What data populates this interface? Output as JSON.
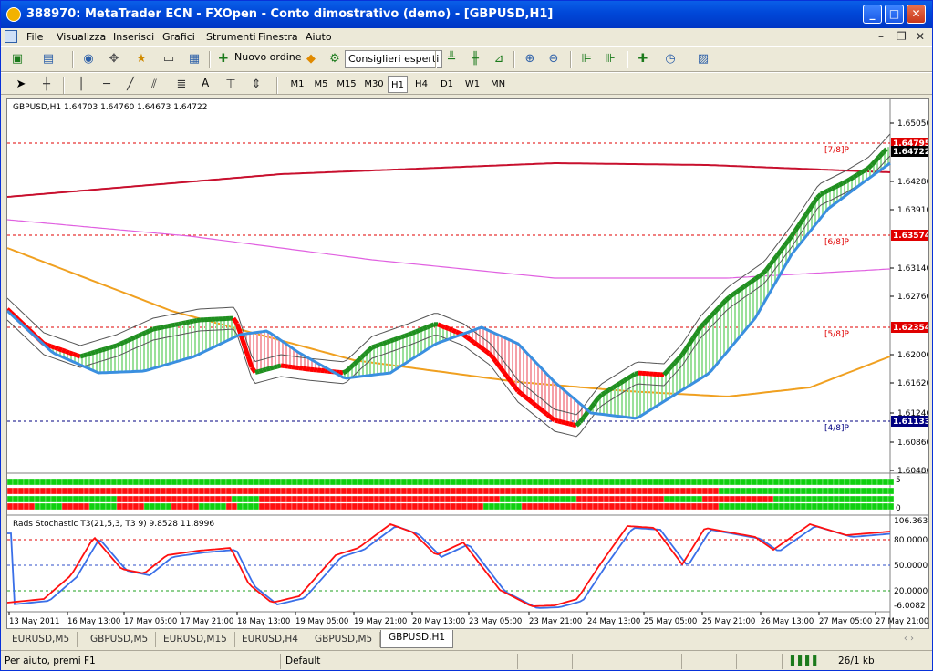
{
  "window": {
    "title": "388970: MetaTrader ECN - FXOpen - Conto dimostrativo (demo) - [GBPUSD,H1]"
  },
  "menu": [
    "File",
    "Visualizza",
    "Inserisci",
    "Grafici",
    "Strumenti",
    "Finestra",
    "Aiuto"
  ],
  "toolbar": {
    "new_order": "Nuovo ordine",
    "expert_advisors": "Consiglieri esperti",
    "text_tool": "A"
  },
  "timeframes": [
    "M1",
    "M5",
    "M15",
    "M30",
    "H1",
    "H4",
    "D1",
    "W1",
    "MN"
  ],
  "active_timeframe": "H1",
  "chart": {
    "info": "GBPUSD,H1  1.64703 1.64760 1.64673 1.64722",
    "price_axis": [
      "1.65050",
      "1.64280",
      "1.63910",
      "1.63140",
      "1.62760",
      "1.62000",
      "1.61620",
      "1.61240",
      "1.60860",
      "1.60480"
    ],
    "price_tags": [
      {
        "label": "1.64795",
        "color": "#e00000"
      },
      {
        "label": "1.64722",
        "color": "#000000"
      },
      {
        "label": "1.63574",
        "color": "#e00000"
      },
      {
        "label": "1.62354",
        "color": "#e00000"
      },
      {
        "label": "1.61133",
        "color": "#000080"
      }
    ],
    "murrey_labels": [
      "[7/8]P",
      "[6/8]P",
      "[5/8]P",
      "[4/8]P"
    ],
    "panel2_axis": [
      "5",
      "0"
    ],
    "stoch_label": "Rads Stochastic T3(21,5,3, T3 9) 9.8528 11.8996",
    "stoch_axis": [
      "106.3635",
      "80.0000",
      "50.0000",
      "20.0000",
      "-6.0082"
    ],
    "time_axis": [
      "13 May 2011",
      "16 May 13:00",
      "17 May 05:00",
      "17 May 21:00",
      "18 May 13:00",
      "19 May 05:00",
      "19 May 21:00",
      "20 May 13:00",
      "23 May 05:00",
      "23 May 21:00",
      "24 May 13:00",
      "25 May 05:00",
      "25 May 21:00",
      "26 May 13:00",
      "27 May 05:00",
      "27 May 21:00"
    ]
  },
  "tabs": [
    "EURUSD,M5",
    "GBPUSD,M5",
    "EURUSD,M15",
    "EURUSD,H4",
    "GBPUSD,M5",
    "GBPUSD,H1"
  ],
  "active_tab": "GBPUSD,H1",
  "status": {
    "help": "Per aiuto, premi F1",
    "profile": "Default",
    "traffic": "26/1 kb"
  },
  "colors": {
    "bull": "#1f8f1f",
    "bear": "#ff0000",
    "ma_blue": "#3a8fe0",
    "ma_orange": "#f0a020",
    "ma_crimson": "#c8102e",
    "ma_magenta": "#e060e0",
    "band": "#555555"
  }
}
